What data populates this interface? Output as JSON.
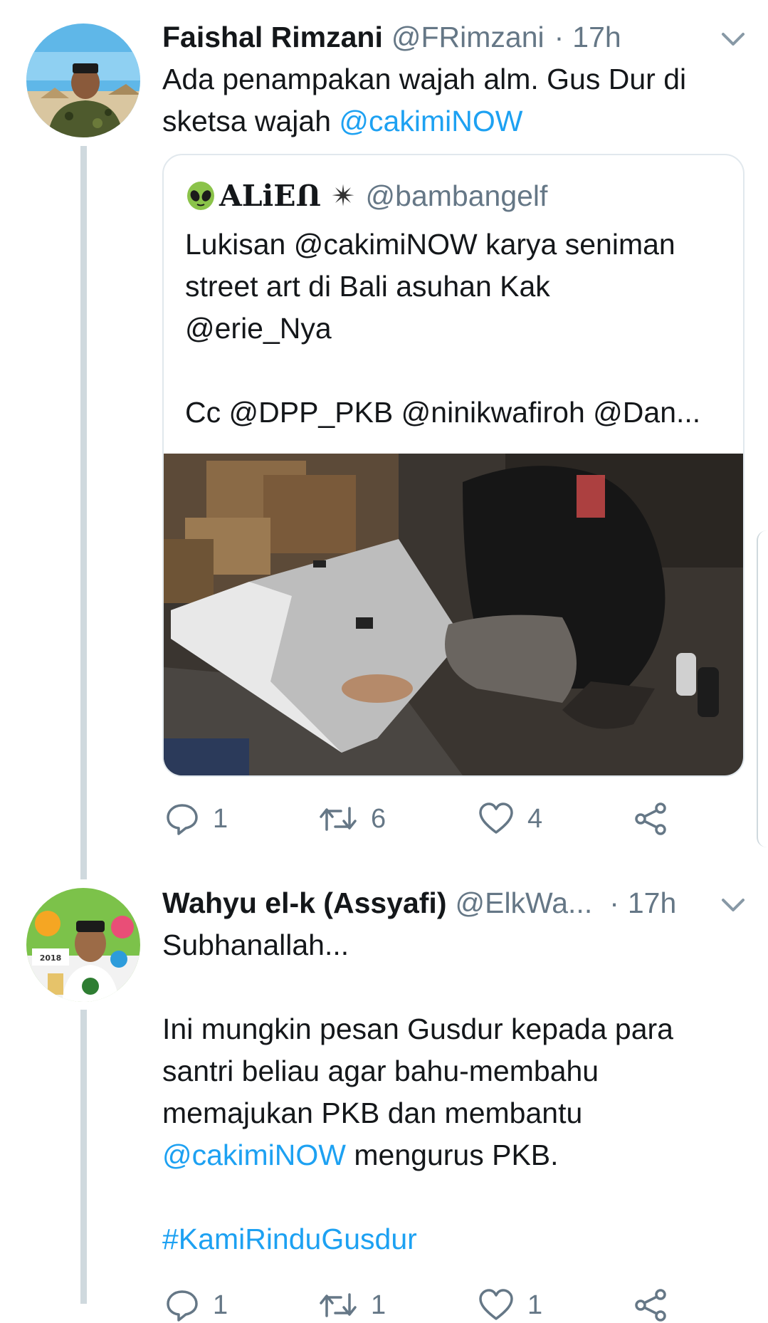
{
  "tweets": [
    {
      "name": "Faishal Rimzani",
      "handle": "@FRimzani",
      "dot": "·",
      "time": "17h",
      "text_plain": "Ada penampakan wajah alm. Gus Dur di sketsa wajah",
      "text_mention": "@cakimiNOW",
      "quote": {
        "emoji": "👽",
        "name": "ALiEՈ",
        "badge": "✴",
        "handle": "@bambangelf",
        "lines": [
          "Lukisan @cakimiNOW karya seniman",
          "street art di Bali asuhan Kak",
          "@erie_Nya",
          "Cc @DPP_PKB @ninikwafiroh @Dan..."
        ]
      },
      "actions": {
        "reply_count": "1",
        "retweet_count": "6",
        "like_count": "4"
      }
    },
    {
      "name": "Wahyu el-k (Assyafi)",
      "handle": "@ElkWa...",
      "dot": "·",
      "time": "17h",
      "line1": "Subhanallah...",
      "para2_plain": "Ini mungkin pesan Gusdur kepada para santri beliau agar bahu-membahu memajukan PKB dan membantu",
      "para2_mention": "@cakimiNOW",
      "para2_tail": "mengurus PKB.",
      "hashtag": "#KamiRinduGusdur",
      "actions": {
        "reply_count": "1",
        "retweet_count": "1",
        "like_count": "1"
      }
    }
  ],
  "colors": {
    "link": "#1da1f2",
    "secondary": "#657786",
    "thread": "#cfd9de"
  }
}
